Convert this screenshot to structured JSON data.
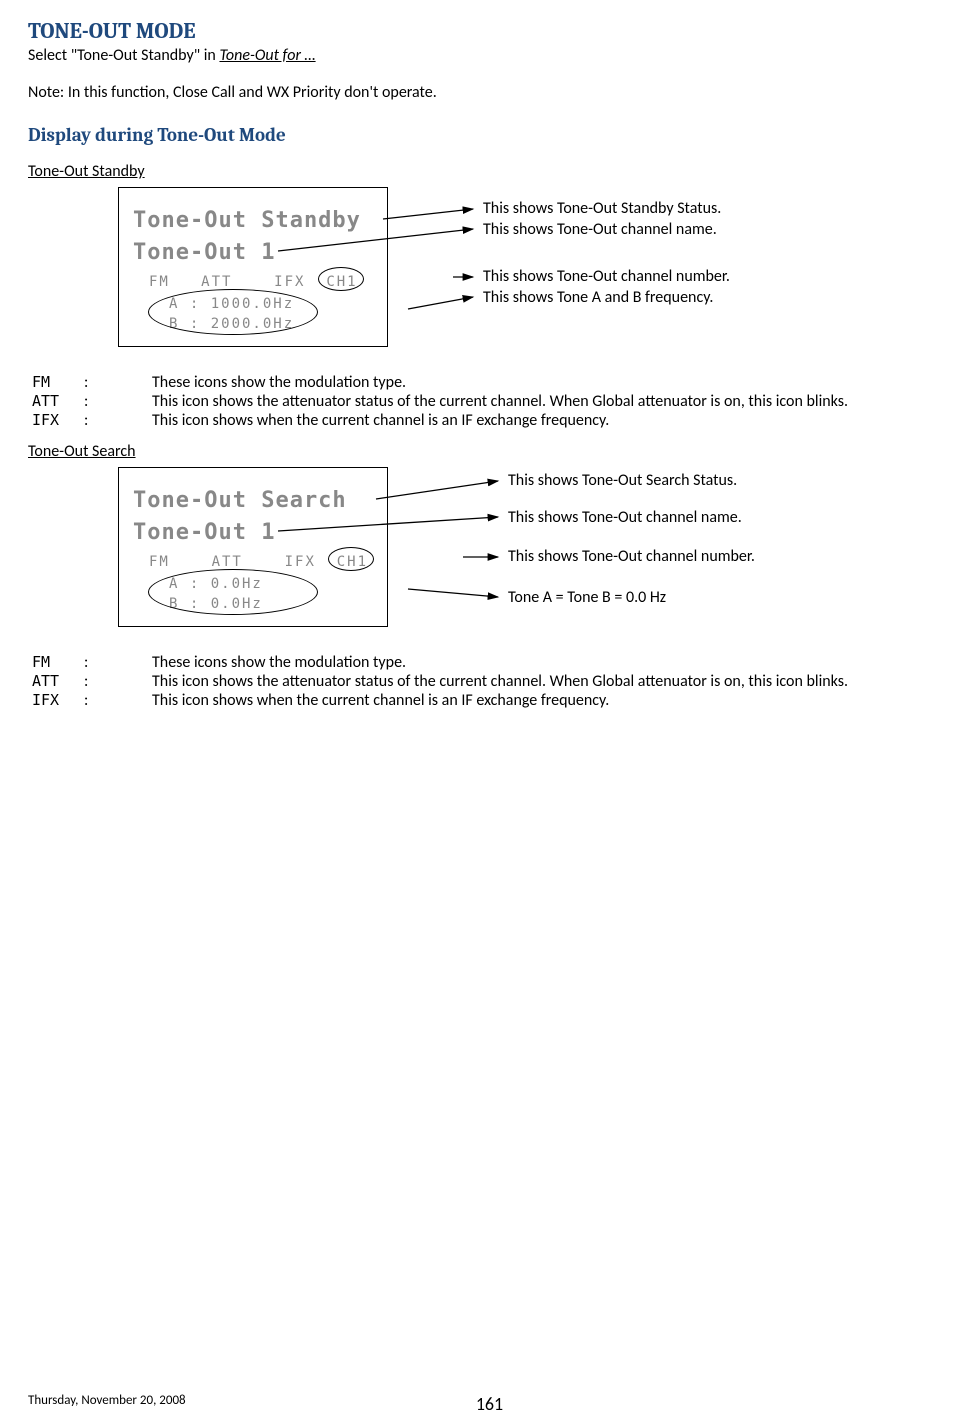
{
  "title": "TONE-OUT MODE",
  "intro_prefix": "Select \"Tone-Out Standby\" in ",
  "intro_link": "Tone-Out for …",
  "note": "Note: In this function, Close Call and WX Priority don't operate.",
  "h2": "Display during Tone-Out Mode",
  "standby": {
    "label": "Tone-Out Standby",
    "lcd": {
      "line1": "Tone-Out Standby",
      "line2": "Tone-Out 1",
      "line3_fm": "FM",
      "line3_att": "ATT",
      "line3_ifx": "IFX",
      "line3_ch": "CH1",
      "line4": "A : 1000.0Hz",
      "line5": "B : 2000.0Hz"
    },
    "callouts": {
      "c1": "This shows Tone-Out Standby Status.",
      "c2": "This shows Tone-Out channel name.",
      "c3": "This shows Tone-Out channel number.",
      "c4": "This shows Tone A and B frequency."
    },
    "desc": {
      "fm_k": "FM",
      "fm_t": "These icons show the modulation type.",
      "att_k": "ATT",
      "att_t": "This icon shows the attenuator status of the current channel. When Global attenuator is on, this icon blinks.",
      "ifx_k": "IFX",
      "ifx_t": "This icon shows when the current channel is an IF exchange frequency."
    }
  },
  "search": {
    "label": "Tone-Out Search",
    "lcd": {
      "line1": "Tone-Out Search",
      "line2": "Tone-Out 1",
      "line3_fm": "FM",
      "line3_att": "ATT",
      "line3_ifx": "IFX",
      "line3_ch": "CH1",
      "line4": "A :    0.0Hz",
      "line5": "B :    0.0Hz"
    },
    "callouts": {
      "c1": "This shows Tone-Out Search Status.",
      "c2": "This shows Tone-Out channel name.",
      "c3": "This shows Tone-Out channel number.",
      "c4": "Tone A = Tone B = 0.0 Hz"
    },
    "desc": {
      "fm_k": "FM",
      "fm_t": "These icons show the modulation type.",
      "att_k": "ATT",
      "att_t": "This icon shows the attenuator status of the current channel. When Global attenuator is on, this icon blinks.",
      "ifx_k": "IFX",
      "ifx_t": "This icon shows when the current channel is an IF exchange frequency."
    }
  },
  "colon": ":",
  "footer": {
    "date": "Thursday, November 20, 2008",
    "page": "161"
  }
}
